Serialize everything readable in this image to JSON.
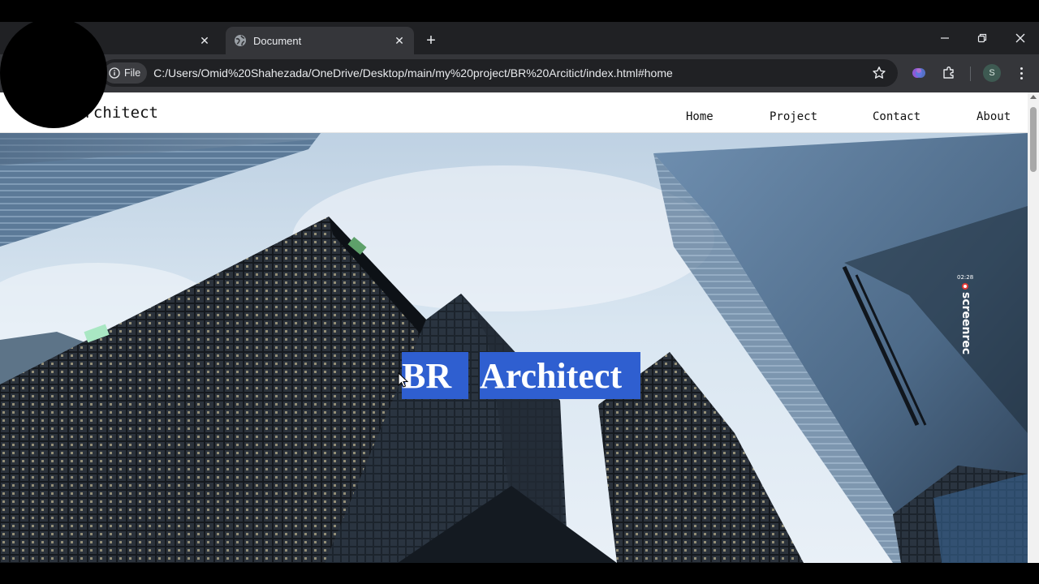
{
  "browser": {
    "tabs": [
      {
        "title": "",
        "active": false
      },
      {
        "title": "Document",
        "active": true
      }
    ],
    "new_tab_icon": "plus-icon",
    "address_chip_label": "File",
    "url": "C:/Users/Omid%20Shahezada/OneDrive/Desktop/main/my%20project/BR%20Arcitict/index.html#home",
    "profile_initial": "S",
    "window_controls": [
      "minimize-icon",
      "restore-icon",
      "close-icon"
    ]
  },
  "site": {
    "logo": "Architect",
    "nav": {
      "home": "Home",
      "project": "Project",
      "contact": "Contact",
      "about": "About"
    },
    "hero": {
      "word1": "BR",
      "word2": "Architect",
      "highlight_color": "#2f5fd0"
    }
  },
  "overlay": {
    "recorder_time": "02:28",
    "recorder_brand": "screenrec"
  }
}
